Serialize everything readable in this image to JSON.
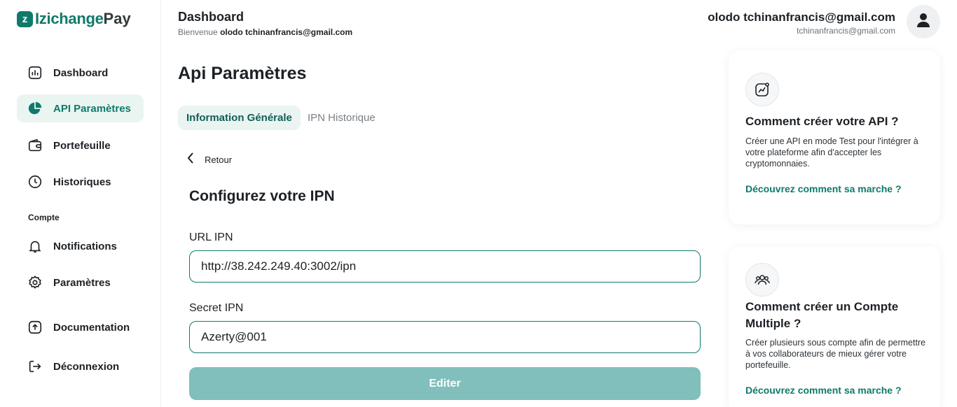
{
  "brand": {
    "mark": "z",
    "name": "Izichange",
    "suffix": "Pay",
    "accent_color": "#0f7a6b"
  },
  "sidebar": {
    "items": [
      {
        "label": "Dashboard",
        "icon": "bar-chart-icon",
        "active": false
      },
      {
        "label": "API Paramètres",
        "icon": "pie-chart-icon",
        "active": true
      },
      {
        "label": "Portefeuille",
        "icon": "wallet-icon",
        "active": false
      },
      {
        "label": "Historiques",
        "icon": "clock-icon",
        "active": false
      }
    ],
    "section_label": "Compte",
    "account_items": [
      {
        "label": "Notifications",
        "icon": "bell-icon"
      },
      {
        "label": "Paramètres",
        "icon": "gear-icon"
      },
      {
        "label": "Documentation",
        "icon": "upload-icon"
      },
      {
        "label": "Déconnexion",
        "icon": "logout-icon"
      }
    ]
  },
  "header": {
    "title": "Dashboard",
    "welcome_prefix": "Bienvenue",
    "welcome_user": "olodo tchinanfrancis@gmail.com",
    "user_name": "olodo tchinanfrancis@gmail.com",
    "user_email": "tchinanfrancis@gmail.com"
  },
  "main": {
    "page_title": "Api Paramètres",
    "tabs": [
      {
        "label": "Information Générale",
        "active": true
      },
      {
        "label": "IPN Historique",
        "active": false
      }
    ],
    "back_label": "Retour",
    "form_title": "Configurez votre IPN",
    "url_label": "URL IPN",
    "url_value": "http://38.242.249.40:3002/ipn",
    "secret_label": "Secret IPN",
    "secret_value": "Azerty@001",
    "submit_label": "Editer"
  },
  "cards": [
    {
      "icon": "chart-sparkle-icon",
      "title": "Comment créer votre API ?",
      "description": "Créer une API en mode Test pour l'intégrer à votre plateforme afin d'accepter les cryptomonnaies.",
      "link": "Découvrez comment sa marche ?"
    },
    {
      "icon": "users-icon",
      "title": "Comment créer un Compte Multiple ?",
      "description": "Créer plusieurs sous compte afin de permettre à vos collaborateurs de mieux gérer votre portefeuille.",
      "link": "Découvrez comment sa marche ?"
    }
  ]
}
